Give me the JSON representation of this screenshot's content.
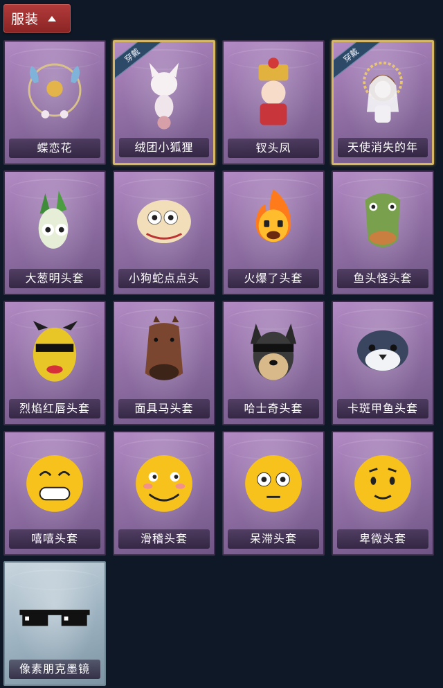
{
  "header": {
    "label": "服装"
  },
  "equipped_badge": "穿戴",
  "items": [
    {
      "name": "蝶恋花",
      "art": "butterfly-flower-ornament-icon",
      "equipped": false
    },
    {
      "name": "绒团小狐狸",
      "art": "fluffy-fox-icon",
      "equipped": true
    },
    {
      "name": "钗头凤",
      "art": "phoenix-crown-doll-icon",
      "equipped": false
    },
    {
      "name": "天使消失的年",
      "art": "angel-veil-doll-icon",
      "equipped": true
    },
    {
      "name": "大葱明头套",
      "art": "green-onion-mask-icon",
      "equipped": false
    },
    {
      "name": "小狗蛇点点头",
      "art": "snake-dog-mask-icon",
      "equipped": false
    },
    {
      "name": "火爆了头套",
      "art": "fireball-mask-icon",
      "equipped": false
    },
    {
      "name": "鱼头怪头套",
      "art": "fish-head-mask-icon",
      "equipped": false
    },
    {
      "name": "烈焰红唇头套",
      "art": "yellow-knit-mask-icon",
      "equipped": false
    },
    {
      "name": "面具马头套",
      "art": "horse-mask-icon",
      "equipped": false
    },
    {
      "name": "哈士奇头套",
      "art": "husky-mask-icon",
      "equipped": false
    },
    {
      "name": "卡斑甲鱼头套",
      "art": "seal-mask-icon",
      "equipped": false
    },
    {
      "name": "嘻嘻头套",
      "art": "grin-emoji-mask-icon",
      "equipped": false
    },
    {
      "name": "滑稽头套",
      "art": "funny-emoji-mask-icon",
      "equipped": false
    },
    {
      "name": "呆滞头套",
      "art": "dazed-emoji-mask-icon",
      "equipped": false
    },
    {
      "name": "卑微头套",
      "art": "humble-emoji-mask-icon",
      "equipped": false
    },
    {
      "name": "像素朋克墨镜",
      "art": "pixel-sunglasses-icon",
      "equipped": false,
      "special": true
    }
  ]
}
